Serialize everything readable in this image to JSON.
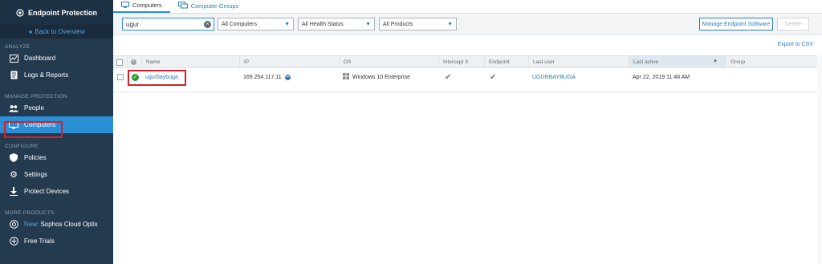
{
  "sidebar": {
    "header": "Endpoint Protection",
    "back": "Back to Overview",
    "sections": {
      "analyze": "ANALYZE",
      "manage": "MANAGE PROTECTION",
      "configure": "CONFIGURE",
      "more": "MORE PRODUCTS"
    },
    "items": {
      "dashboard": "Dashboard",
      "logs": "Logs & Reports",
      "people": "People",
      "computers": "Computers",
      "policies": "Policies",
      "settings": "Settings",
      "protect": "Protect Devices",
      "new_prefix": "New:",
      "cloud_optix": " Sophos Cloud Optix",
      "free_trials": "Free Trials"
    }
  },
  "tabs": {
    "computers": "Computers",
    "groups": "Computer Groups"
  },
  "filters": {
    "search_value": "ugur",
    "computers_select": "All Computers",
    "health_select": "All Health Status",
    "products_select": "All Products",
    "manage_button": "Manage Endpoint Software",
    "delete_button": "Delete"
  },
  "export": "Export to CSV",
  "table": {
    "columns": {
      "name": "Name",
      "ip": "IP",
      "os": "OS",
      "intercept": "Intercept X",
      "endpoint": "Endpoint",
      "last_user": "Last user",
      "last_active": "Last active",
      "group": "Group"
    },
    "rows": [
      {
        "name": "ugurbaybuga",
        "ip": "169.254.117.11",
        "os": "Windows 10 Enterprise",
        "last_user": "UGURBAYBUGA",
        "last_active": "Apr 22, 2019 11:48 AM",
        "group": ""
      }
    ]
  },
  "colors": {
    "sidebar_bg": "#243a4e",
    "accent": "#2b8fd6",
    "highlight": "#d61f2c",
    "healthy": "#2f9b3a"
  }
}
